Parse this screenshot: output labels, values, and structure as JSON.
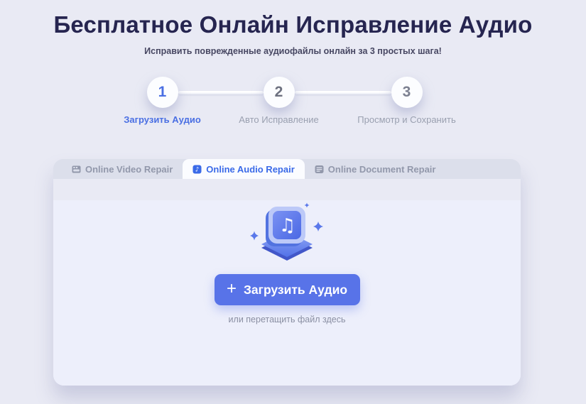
{
  "page": {
    "title": "Бесплатное Онлайн Исправление Аудио",
    "subtitle": "Исправить поврежденные аудиофайлы онлайн за 3 простых шага!"
  },
  "steps": [
    {
      "number": "1",
      "label": "Загрузить Аудио",
      "active": true
    },
    {
      "number": "2",
      "label": "Авто Исправление",
      "active": false
    },
    {
      "number": "3",
      "label": "Просмотр и Сохранить",
      "active": false
    }
  ],
  "tabs": [
    {
      "label": "Online Video Repair",
      "icon": "film-icon",
      "active": false
    },
    {
      "label": "Online Audio Repair",
      "icon": "music-note-icon",
      "active": true
    },
    {
      "label": "Online Document Repair",
      "icon": "document-icon",
      "active": false
    }
  ],
  "uploader": {
    "button_label": "Загрузить Аудио",
    "drop_hint": "или перетащить файл здесь"
  },
  "icons": {
    "plus": "+",
    "music_note_glyph": "♫",
    "small_note_glyph": "♪"
  },
  "colors": {
    "page_bg": "#e9eaf4",
    "title_navy": "#262550",
    "accent_blue": "#3a6ae8",
    "button_blue": "#5873e8",
    "tabbar_bg": "#dcdfeb",
    "panel_bg": "#edeffb",
    "inactive_gray": "#9aa0b0"
  }
}
